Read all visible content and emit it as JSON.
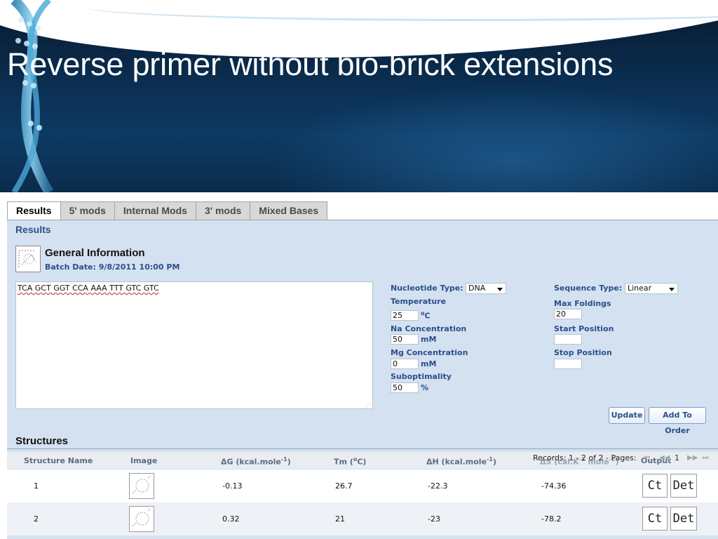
{
  "slide": {
    "title": "Reverse primer without bio-brick extensions"
  },
  "tabs": [
    {
      "label": "Results",
      "active": true
    },
    {
      "label": "5' mods",
      "active": false
    },
    {
      "label": "Internal Mods",
      "active": false
    },
    {
      "label": "3' mods",
      "active": false
    },
    {
      "label": "Mixed Bases",
      "active": false
    }
  ],
  "results": {
    "heading": "Results",
    "general_info": {
      "title": "General Information",
      "batch_date": "Batch Date: 9/8/2011 10:00 PM"
    },
    "sequence": "TCA GCT GGT CCA AAA TTT GTC GTC"
  },
  "params": {
    "nucleotide_type": {
      "label": "Nucleotide Type:",
      "value": "DNA"
    },
    "temperature": {
      "label": "Temperature",
      "value": "25",
      "unit": "oC"
    },
    "na_concentration": {
      "label": "Na Concentration",
      "value": "50",
      "unit": "mM"
    },
    "mg_concentration": {
      "label": "Mg Concentration",
      "value": "0",
      "unit": "mM"
    },
    "suboptimality": {
      "label": "Suboptimality",
      "value": "50",
      "unit": "%"
    },
    "sequence_type": {
      "label": "Sequence Type:",
      "value": "Linear"
    },
    "max_foldings": {
      "label": "Max Foldings",
      "value": "20"
    },
    "start_position": {
      "label": "Start Position",
      "value": ""
    },
    "stop_position": {
      "label": "Stop Position",
      "value": ""
    }
  },
  "buttons": {
    "update": "Update",
    "add_to_order": "Add To Order"
  },
  "structures": {
    "title": "Structures",
    "columns": {
      "name": "Structure Name",
      "image": "Image",
      "dg": "ΔG (kcal.mole",
      "dg_sup": "-1",
      "dg_close": ")",
      "tm": "Tm (",
      "tm_sup": "o",
      "tm_close": "C)",
      "dh": "ΔH (kcal.mole",
      "dh_sup": "-1",
      "dh_close": ")",
      "ds": "ΔS (cal.K",
      "ds_sup": "-1",
      "ds_mid": "mole",
      "ds_sup2": "-1",
      "ds_close": ")",
      "output": "Output"
    },
    "records_text": "Records: 1 - 2 of 2 - Pages:",
    "pager": {
      "first": "⏮",
      "prev": "◀◀",
      "page": "1",
      "next": "▶▶",
      "last": "⏭"
    },
    "rows": [
      {
        "name": "1",
        "dg": "-0.13",
        "tm": "26.7",
        "dh": "-22.3",
        "ds": "-74.36",
        "ct": "Ct",
        "det": "Det"
      },
      {
        "name": "2",
        "dg": "0.32",
        "tm": "21",
        "dh": "-23",
        "ds": "-78.2",
        "ct": "Ct",
        "det": "Det"
      }
    ]
  },
  "colors": {
    "banner": "#0b2f52",
    "panel": "#d4e1f0",
    "label": "#2a4f8a"
  }
}
